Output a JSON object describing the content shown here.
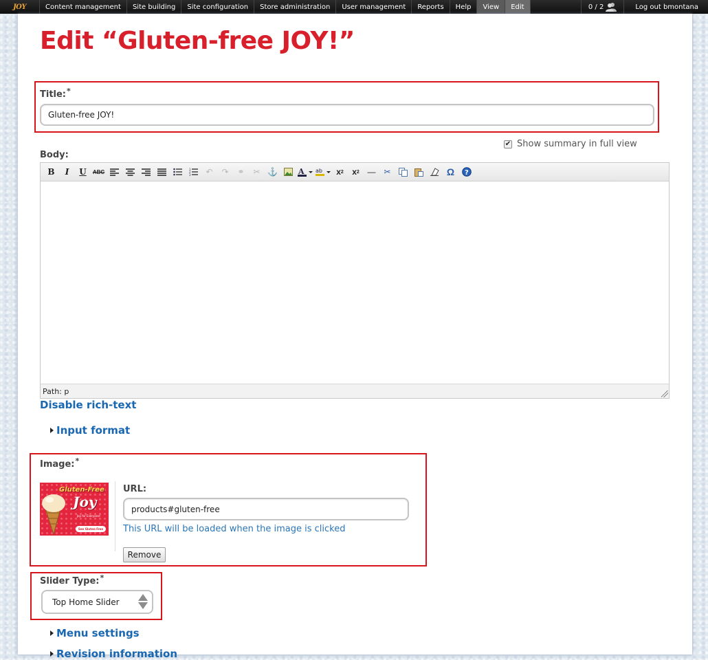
{
  "toolbar": {
    "logo_text": "JOY",
    "menu": [
      "Content management",
      "Site building",
      "Site configuration",
      "Store administration",
      "User management",
      "Reports",
      "Help"
    ],
    "tabs": [
      "View",
      "Edit"
    ],
    "user_count": "0 / 2",
    "logout": "Log out bmontana"
  },
  "page": {
    "title": "Edit “Gluten-free JOY!”"
  },
  "form": {
    "title_label": "Title:",
    "required_mark": "*",
    "title_value": "Gluten-free JOY!",
    "show_summary_label": "Show summary in full view",
    "show_summary_checked": true,
    "body_label": "Body:",
    "editor_path": "Path: p",
    "disable_richtext": "Disable rich-text",
    "input_format": "Input format",
    "image_label": "Image:",
    "image_thumb": {
      "line1": "Gluten-Free",
      "line2": "Joy",
      "line3": "Joy for Everyone!",
      "button": "See Gluten-Free"
    },
    "url_label": "URL:",
    "url_value": "products#gluten-free",
    "url_description": "This URL will be loaded when the image is clicked",
    "remove_button": "Remove",
    "slider_type_label": "Slider Type:",
    "slider_type_value": "Top Home Slider",
    "menu_settings": "Menu settings",
    "revision_information": "Revision information"
  },
  "colors": {
    "title": "#d8202c",
    "link": "#1967b0",
    "highlight_box": "#d8141b"
  },
  "editor_tools": [
    "bold-icon",
    "italic-icon",
    "underline-icon",
    "strikethrough-icon",
    "align-left-icon",
    "align-center-icon",
    "align-right-icon",
    "align-justify-icon",
    "bulleted-list-icon",
    "numbered-list-icon",
    "undo-icon",
    "redo-icon",
    "link-icon",
    "unlink-icon",
    "anchor-icon",
    "image-icon",
    "text-color-icon",
    "background-color-icon",
    "superscript-icon",
    "subscript-icon",
    "horizontal-rule-icon",
    "cut-icon",
    "copy-icon",
    "paste-icon",
    "remove-format-icon",
    "special-char-icon",
    "help-icon"
  ]
}
